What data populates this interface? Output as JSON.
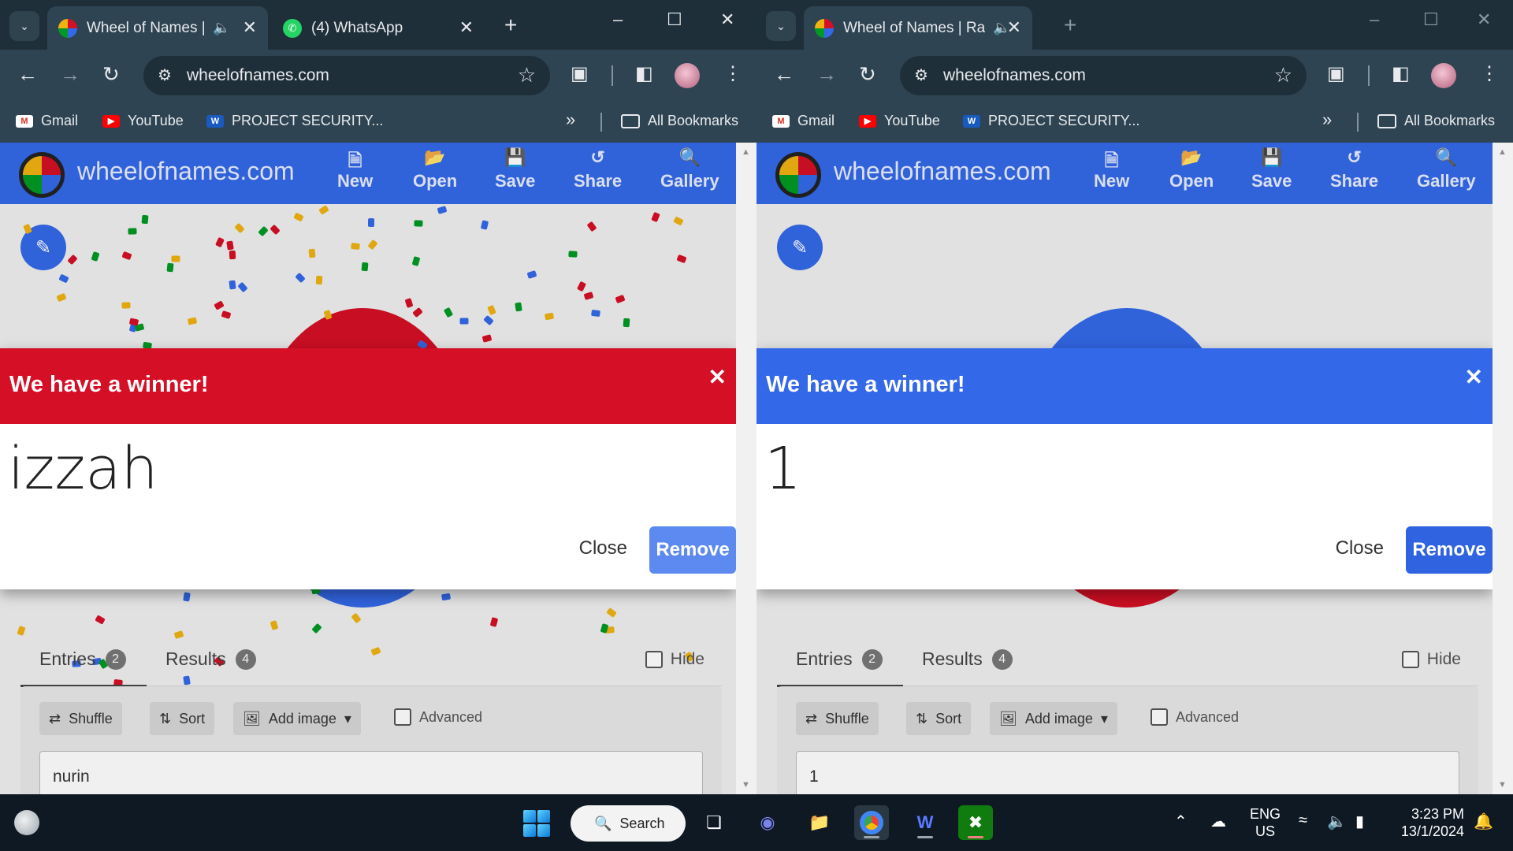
{
  "left_window": {
    "tabs": [
      {
        "title": "Wheel of Names |",
        "active": true
      },
      {
        "title": "(4) WhatsApp",
        "active": false
      }
    ],
    "url": "wheelofnames.com",
    "dialog": {
      "title": "We have a winner!",
      "winner": "izzah",
      "header_color": "#d50f25"
    },
    "entries_count": "2",
    "results_count": "4",
    "first_entry": "nurin"
  },
  "right_window": {
    "tabs": [
      {
        "title": "Wheel of Names | Random",
        "active": true
      }
    ],
    "url": "wheelofnames.com",
    "dialog": {
      "title": "We have a winner!",
      "winner": "1",
      "header_color": "#3369e8"
    },
    "entries_count": "2",
    "results_count": "4",
    "first_entry": "1"
  },
  "bookmarks": {
    "gmail": "Gmail",
    "youtube": "YouTube",
    "project": "PROJECT SECURITY...",
    "all": "All Bookmarks"
  },
  "site": {
    "name": "wheelofnames.com",
    "nav": {
      "new": "New",
      "open": "Open",
      "save": "Save",
      "share": "Share",
      "gallery": "Gallery"
    }
  },
  "labels": {
    "entries": "Entries",
    "results": "Results",
    "hide": "Hide",
    "shuffle": "Shuffle",
    "sort": "Sort",
    "add_image": "Add image",
    "advanced": "Advanced",
    "close": "Close",
    "remove": "Remove"
  },
  "taskbar": {
    "search": "Search",
    "lang_top": "ENG",
    "lang_bottom": "US",
    "time": "3:23 PM",
    "date": "13/1/2024"
  },
  "colors": {
    "brand_blue": "#3369e8",
    "brand_red": "#d50f25",
    "remove_disabled": "#5c8af0",
    "remove_enabled": "#2f63e0"
  }
}
